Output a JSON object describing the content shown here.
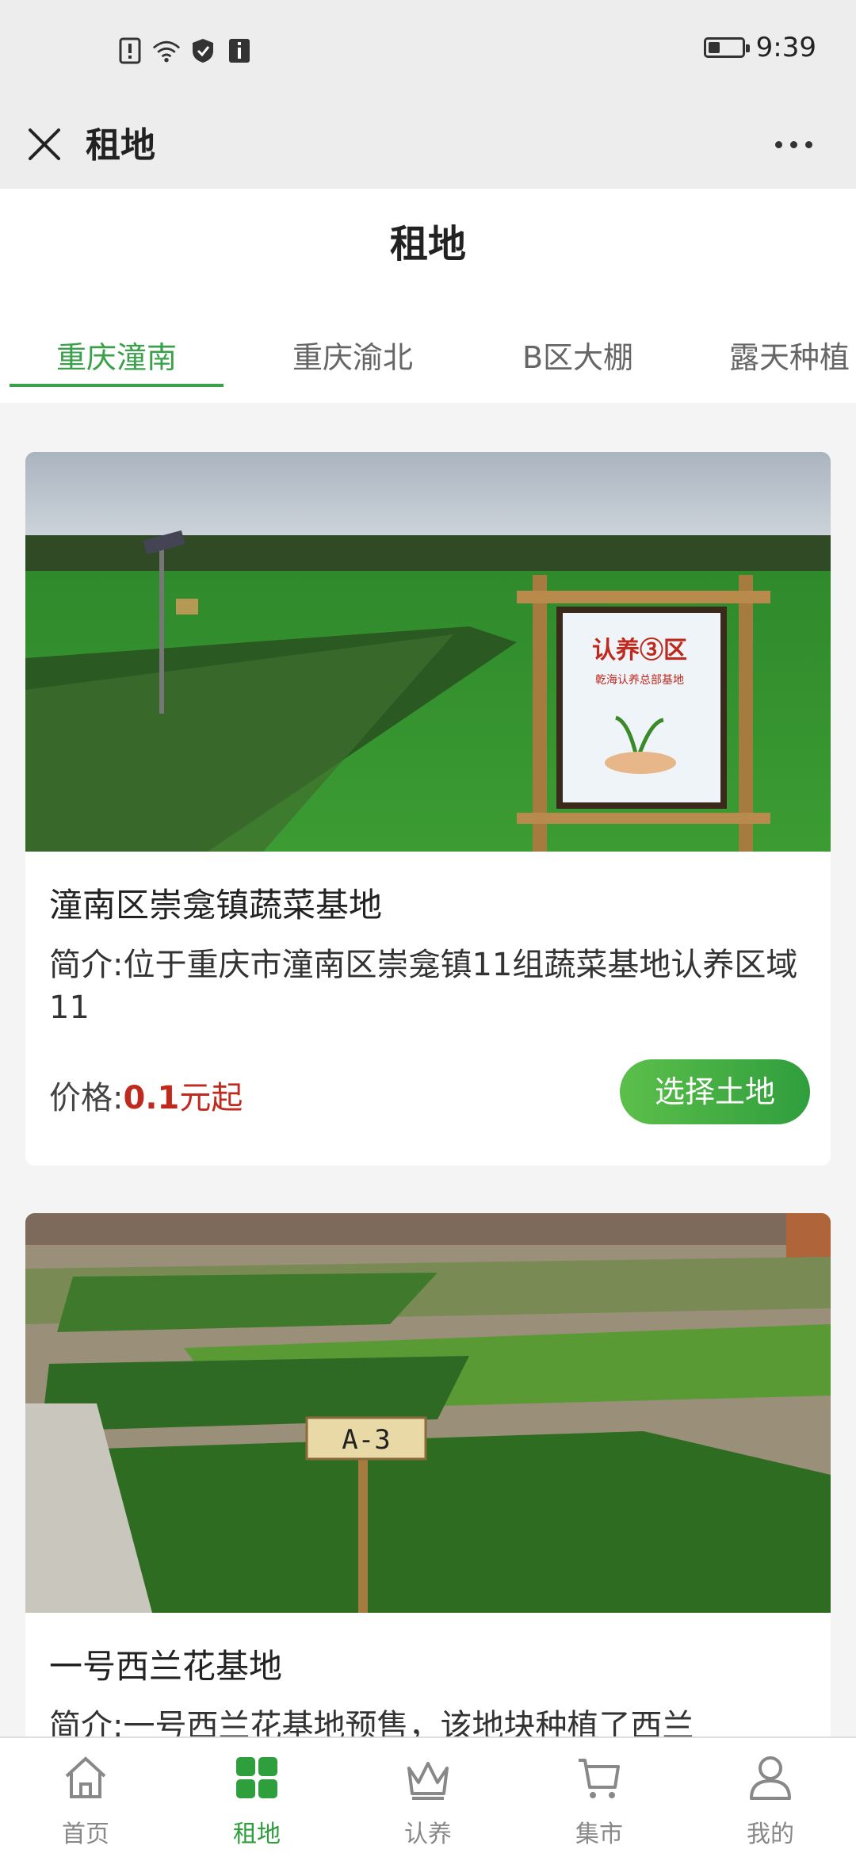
{
  "status_bar": {
    "time": "9:39",
    "battery_level": 0.35
  },
  "app_header": {
    "title": "租地"
  },
  "page": {
    "title": "租地"
  },
  "tabs": [
    {
      "label": "重庆潼南",
      "active": true
    },
    {
      "label": "重庆渝北",
      "active": false
    },
    {
      "label": "B区大棚",
      "active": false
    },
    {
      "label": "露天种植",
      "active": false
    }
  ],
  "cards": [
    {
      "title": "潼南区崇龛镇蔬菜基地",
      "desc": "简介:位于重庆市潼南区崇龛镇11组蔬菜基地认养区域11",
      "price_label": "价格:",
      "price_value": "0.1",
      "price_unit": "元起",
      "button": "选择土地",
      "sign_text": "认养③区",
      "sign_subtext": "乾海认养总部基地"
    },
    {
      "title": "一号西兰花基地",
      "desc": "简介:一号西兰花基地预售，该地块种植了西兰",
      "sign_text": "A-3"
    }
  ],
  "bottom_nav": [
    {
      "label": "首页",
      "icon": "home-icon",
      "active": false
    },
    {
      "label": "租地",
      "icon": "grid-icon",
      "active": true
    },
    {
      "label": "认养",
      "icon": "crown-icon",
      "active": false
    },
    {
      "label": "集市",
      "icon": "cart-icon",
      "active": false
    },
    {
      "label": "我的",
      "icon": "user-icon",
      "active": false
    }
  ],
  "colors": {
    "accent": "#3aa14a",
    "price": "#c0291d"
  }
}
